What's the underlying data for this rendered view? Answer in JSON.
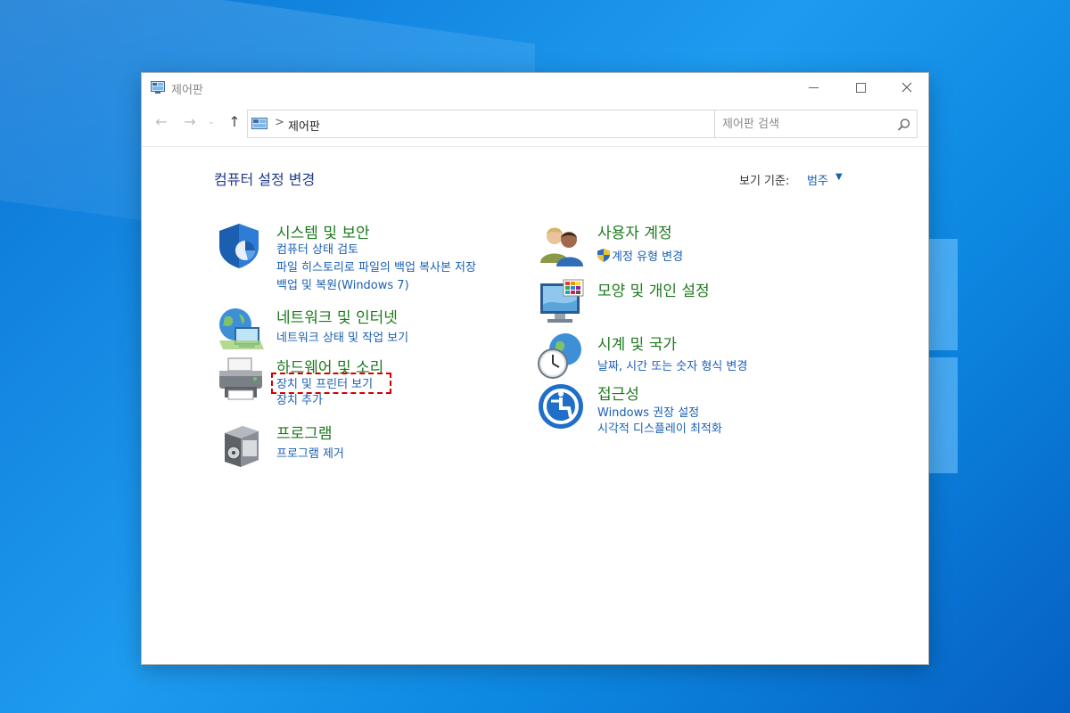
{
  "window": {
    "title": "제어판"
  },
  "address": {
    "crumb": "제어판",
    "separator": ">"
  },
  "search": {
    "placeholder": "제어판 검색"
  },
  "page": {
    "title": "컴퓨터 설정 변경",
    "view_by_label": "보기 기준:",
    "view_by_value": "범주"
  },
  "categories": {
    "system": {
      "heading": "시스템 및 보안",
      "links": [
        "컴퓨터 상태 검토",
        "파일 히스토리로 파일의 백업 복사본 저장",
        "백업 및 복원(Windows 7)"
      ],
      "icon": "shield-icon"
    },
    "network": {
      "heading": "네트워크 및 인터넷",
      "links": [
        "네트워크 상태 및 작업 보기"
      ],
      "icon": "globe-network-icon"
    },
    "hardware": {
      "heading": "하드웨어 및 소리",
      "links": [
        "장치 및 프린터 보기",
        "장치 추가"
      ],
      "icon": "printer-icon"
    },
    "programs": {
      "heading": "프로그램",
      "links": [
        "프로그램 제거"
      ],
      "icon": "program-box-icon"
    },
    "users": {
      "heading": "사용자 계정",
      "links": [
        "계정 유형 변경"
      ],
      "icon": "users-icon"
    },
    "appearance": {
      "heading": "모양 및 개인 설정",
      "links": [],
      "icon": "monitor-palette-icon"
    },
    "clock": {
      "heading": "시계 및 국가",
      "links": [
        "날짜, 시간 또는 숫자 형식 변경"
      ],
      "icon": "clock-globe-icon"
    },
    "access": {
      "heading": "접근성",
      "links": [
        "Windows 권장 설정",
        "시각적 디스플레이 최적화"
      ],
      "icon": "accessibility-icon"
    }
  },
  "colors": {
    "heading_green": "#1d7a1d",
    "link_blue": "#1a5fb4",
    "title_navy": "#1e3a8a",
    "highlight_red": "#d40000"
  }
}
